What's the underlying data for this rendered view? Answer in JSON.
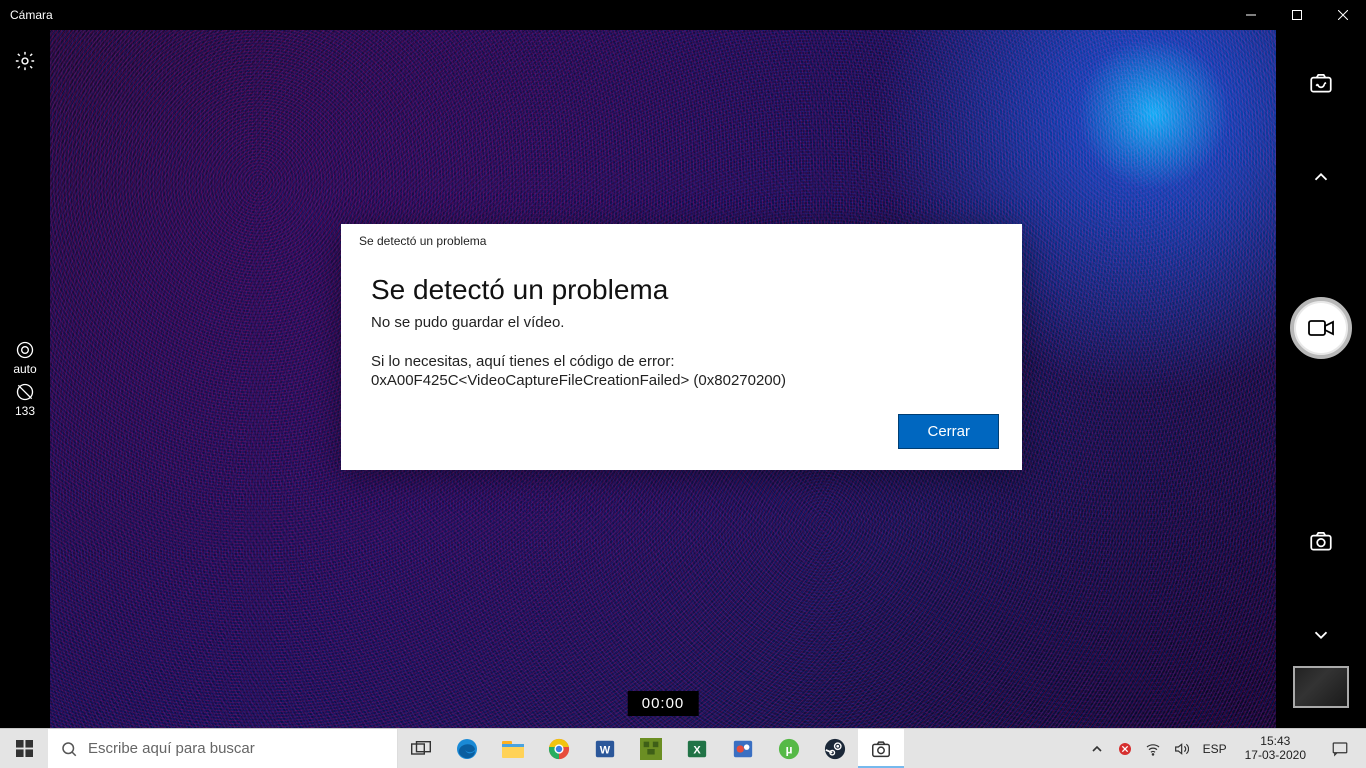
{
  "window": {
    "title": "Cámara"
  },
  "left_controls": {
    "focus_label": "auto",
    "timer_value": "133"
  },
  "timer": "00:00",
  "dialog": {
    "caption": "Se detectó un problema",
    "heading": "Se detectó un problema",
    "message": "No se pudo guardar el vídeo.",
    "error_prefix": "Si lo necesitas, aquí tienes el código de error:",
    "error_code": "0xA00F425C<VideoCaptureFileCreationFailed> (0x80270200)",
    "close_label": "Cerrar"
  },
  "taskbar": {
    "search_placeholder": "Escribe aquí para buscar",
    "language": "ESP",
    "time": "15:43",
    "date": "17-03-2020"
  }
}
